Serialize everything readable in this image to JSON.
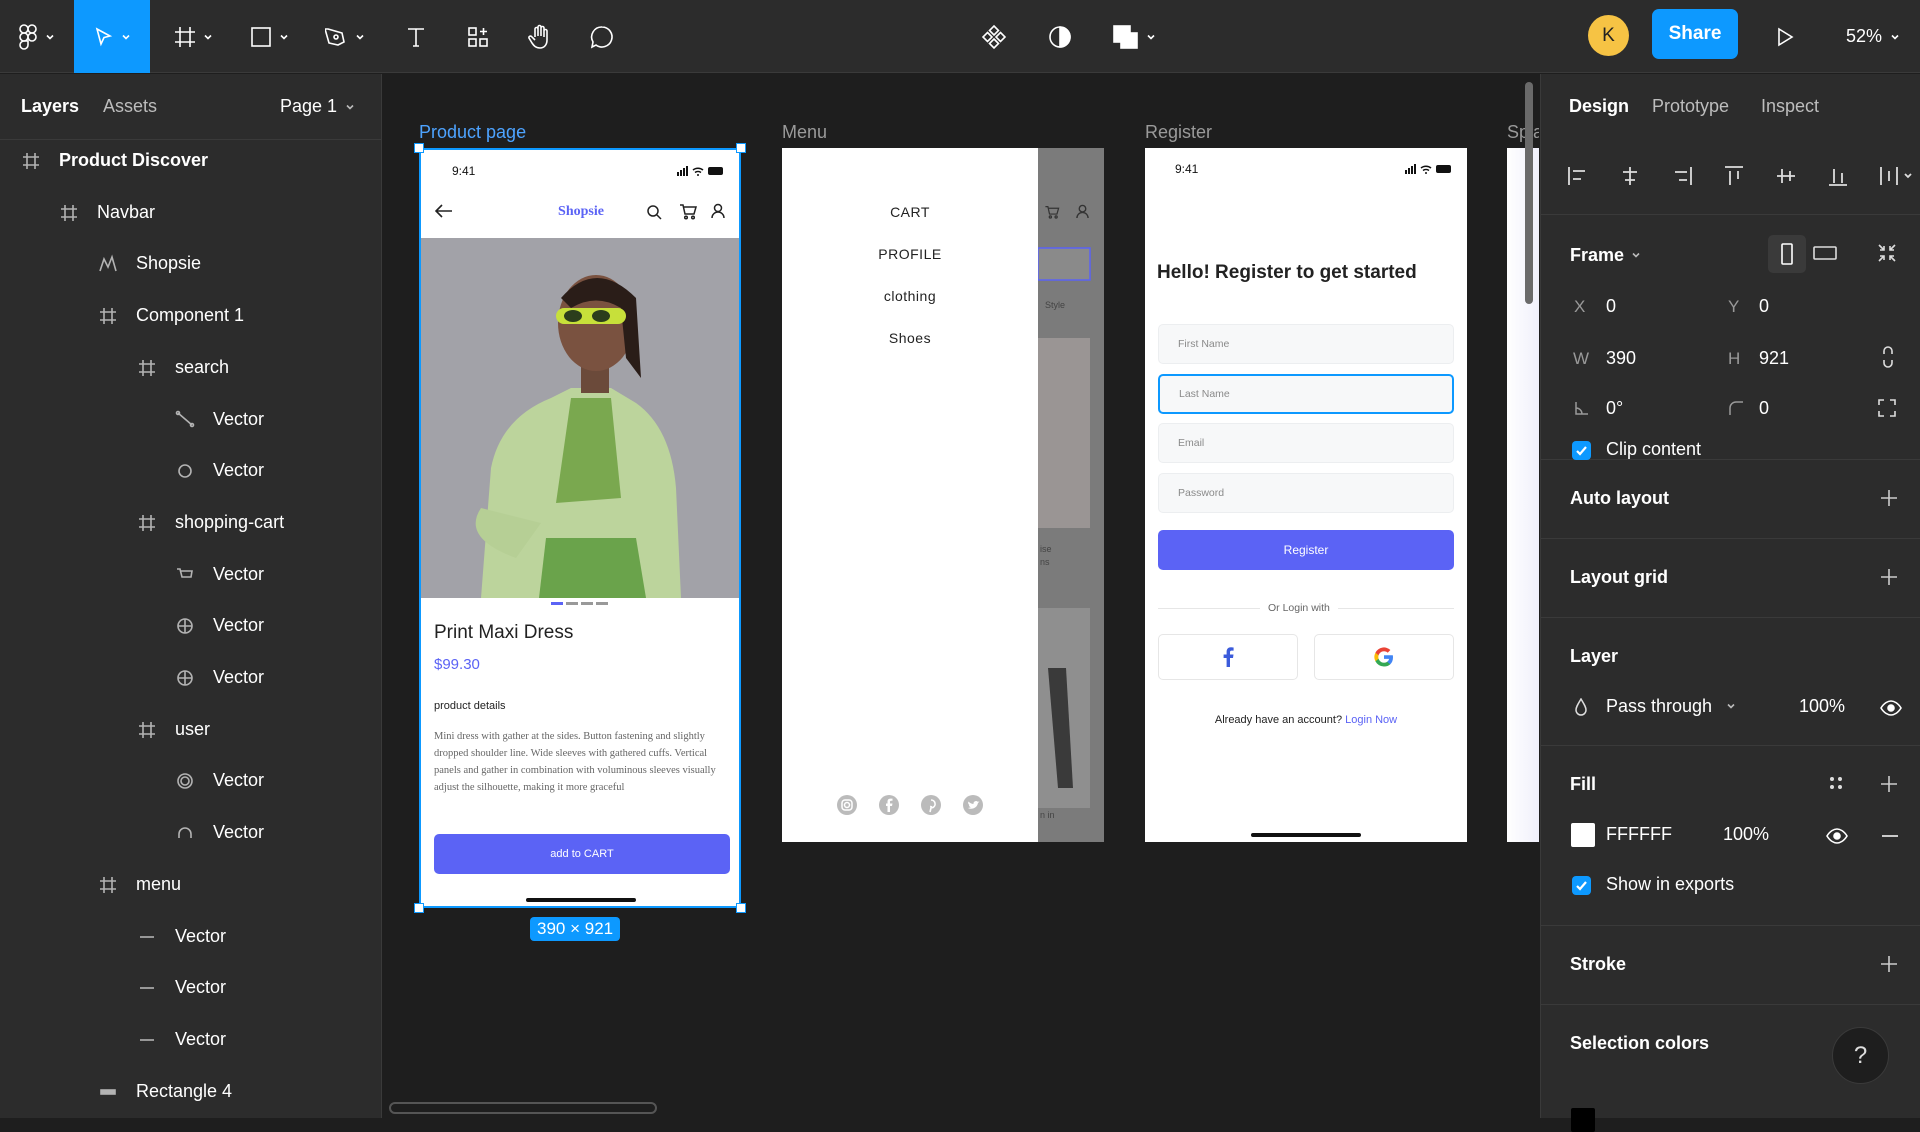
{
  "toolbar": {
    "zoom": "52%",
    "share_label": "Share",
    "avatar_initial": "K"
  },
  "left_panel": {
    "tabs": [
      "Layers",
      "Assets"
    ],
    "page": "Page 1",
    "layers": [
      {
        "label": "Product Discover",
        "icon": "frame-icon",
        "bold": true
      },
      {
        "label": "Navbar",
        "icon": "frame-icon"
      },
      {
        "label": "Shopsie",
        "icon": "vector-path-icon"
      },
      {
        "label": "Component 1",
        "icon": "frame-icon"
      },
      {
        "label": "search",
        "icon": "frame-icon"
      },
      {
        "label": "Vector",
        "icon": "line-vector-icon"
      },
      {
        "label": "Vector",
        "icon": "circle-vector-icon"
      },
      {
        "label": "shopping-cart",
        "icon": "frame-icon"
      },
      {
        "label": "Vector",
        "icon": "cart-vector-icon"
      },
      {
        "label": "Vector",
        "icon": "target-vector-icon"
      },
      {
        "label": "Vector",
        "icon": "target-vector-icon"
      },
      {
        "label": "user",
        "icon": "frame-icon"
      },
      {
        "label": "Vector",
        "icon": "ring-vector-icon"
      },
      {
        "label": "Vector",
        "icon": "arc-vector-icon"
      },
      {
        "label": "menu",
        "icon": "frame-icon"
      },
      {
        "label": "Vector",
        "icon": "dash-vector-icon"
      },
      {
        "label": "Vector",
        "icon": "dash-vector-icon"
      },
      {
        "label": "Vector",
        "icon": "dash-vector-icon"
      },
      {
        "label": "Rectangle 4",
        "icon": "rectangle-icon"
      }
    ]
  },
  "canvas": {
    "frames": {
      "product": {
        "label": "Product page",
        "time": "9:41",
        "brand": "Shopsie",
        "title": "Print Maxi Dress",
        "price": "$99.30",
        "details_heading": "product details",
        "description": "Mini dress with gather at the sides. Button fastening and slightly dropped shoulder line. Wide sleeves with gathered cuffs. Vertical panels and gather in combination with voluminous sleeves visually adjust the silhouette, making it more graceful",
        "cta": "add to CART"
      },
      "menu": {
        "label": "Menu",
        "items": [
          "CART",
          "PROFILE",
          "clothing",
          "Shoes"
        ],
        "peek_text_1": "Style",
        "peek_text_2": "ise",
        "peek_text_3": "ns",
        "peek_text_4": "n in"
      },
      "register": {
        "label": "Register",
        "time": "9:41",
        "heading": "Hello! Register to get started",
        "fields": [
          "First Name",
          "Last Name",
          "Email",
          "Password"
        ],
        "button": "Register",
        "divider": "Or Login with",
        "footer_text": "Already have an account?",
        "footer_link": "Login Now"
      },
      "splash": {
        "label": "Spla"
      }
    },
    "selection_size": "390 × 921"
  },
  "right_panel": {
    "tabs": [
      "Design",
      "Prototype",
      "Inspect"
    ],
    "frame": {
      "title": "Frame",
      "x_label": "X",
      "x": "0",
      "y_label": "Y",
      "y": "0",
      "w_label": "W",
      "w": "390",
      "h_label": "H",
      "h": "921",
      "rotation": "0°",
      "radius": "0",
      "clip_content": "Clip content"
    },
    "auto_layout": "Auto layout",
    "layout_grid": "Layout grid",
    "layer": {
      "title": "Layer",
      "blend": "Pass through",
      "opacity": "100%"
    },
    "fill": {
      "title": "Fill",
      "hex": "FFFFFF",
      "opacity": "100%",
      "show_in_exports": "Show in exports"
    },
    "stroke": "Stroke",
    "selection_colors": "Selection colors",
    "help": "?"
  },
  "colors": {
    "accent": "#0d99ff",
    "button_purple": "#5b63f5",
    "panel": "#2c2c2c",
    "canvas": "#1e1e1e",
    "avatar": "#f6c344"
  }
}
